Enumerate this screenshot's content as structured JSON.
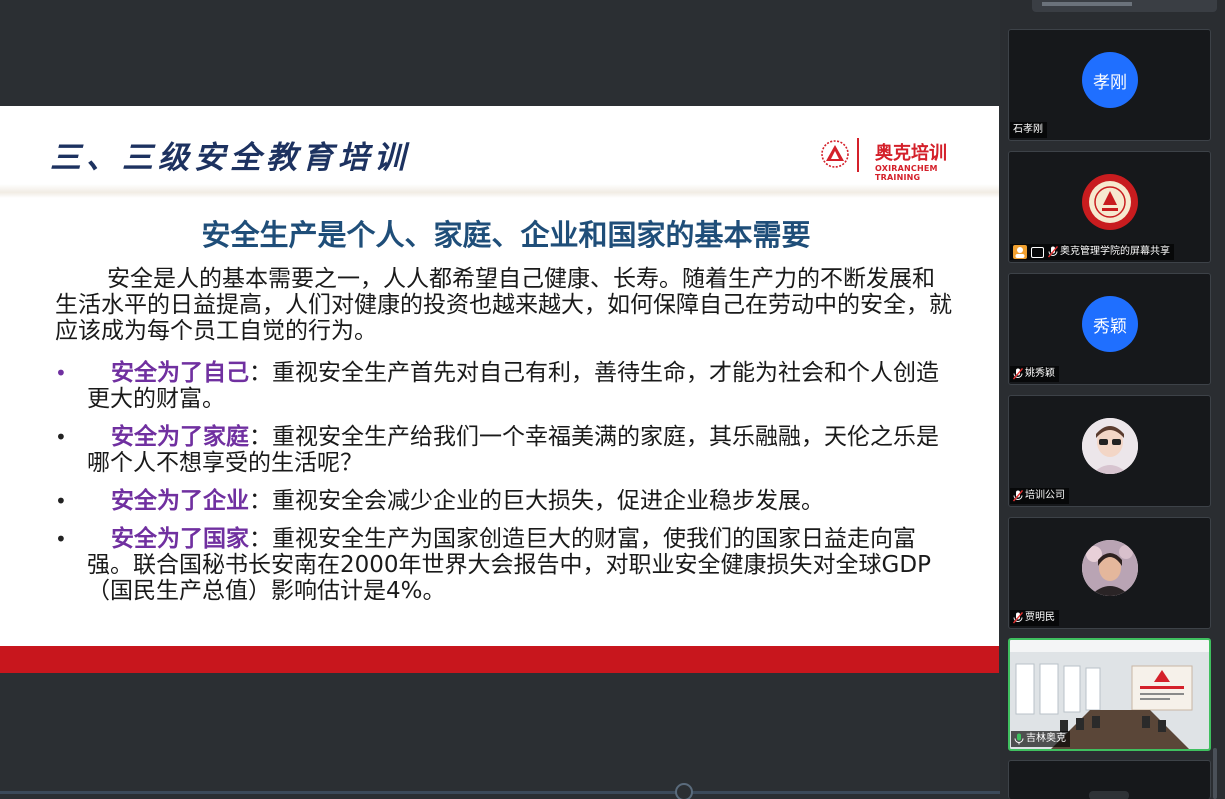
{
  "slide": {
    "title": "三、三级安全教育培训",
    "logo": {
      "cn": "奥克培训",
      "en": "OXIRANCHEM TRAINING"
    },
    "heading": "安全生产是个人、家庭、企业和国家的基本需要",
    "intro": "安全是人的基本需要之一，人人都希望自己健康、长寿。随着生产力的不断发展和生活水平的日益提高，人们对健康的投资也越来越大，如何保障自己在劳动中的安全，就应该成为每个员工自觉的行为。",
    "bullets": [
      {
        "key": "安全为了自己",
        "text": "：重视安全生产首先对自己有利，善待生命，才能为社会和个人创造更大的财富。"
      },
      {
        "key": "安全为了家庭",
        "text": "：重视安全生产给我们一个幸福美满的家庭，其乐融融，天伦之乐是哪个人不想享受的生活呢？"
      },
      {
        "key": "安全为了企业",
        "text": "：重视安全会减少企业的巨大损失，促进企业稳步发展。"
      },
      {
        "key": "安全为了国家",
        "text": "：重视安全生产为国家创造巨大的财富，使我们的国家日益走向富强。联合国秘书长安南在2000年世界大会报告中，对职业安全健康损失对全球GDP（国民生产总值）影响估计是4%。"
      }
    ],
    "bullet_glyph": "•"
  },
  "participants": [
    {
      "name": "石孝刚",
      "avatar_text": "孝刚",
      "avatar": "text",
      "icons": []
    },
    {
      "name": "奥克管理学院的屏幕共享",
      "avatar_text": "",
      "avatar": "logo",
      "icons": [
        "person-icon",
        "screen-share-icon",
        "mic-muted-icon"
      ]
    },
    {
      "name": "姚秀颖",
      "avatar_text": "秀颖",
      "avatar": "text",
      "icons": [
        "mic-muted-icon"
      ]
    },
    {
      "name": "培训公司",
      "avatar_text": "",
      "avatar": "photo",
      "icons": [
        "mic-muted-icon"
      ]
    },
    {
      "name": "贾明民",
      "avatar_text": "",
      "avatar": "photo",
      "icons": [
        "mic-muted-icon"
      ]
    },
    {
      "name": "吉林奥克",
      "avatar_text": "",
      "avatar": "video",
      "icons": [
        "mic-active-icon"
      ]
    }
  ],
  "colors": {
    "title": "#1d3260",
    "heading": "#1f4e79",
    "bullet_key": "#7030a0",
    "brand_red": "#c8161d",
    "avatar_blue": "#1f6fff",
    "active_border": "#3fbf5f"
  }
}
